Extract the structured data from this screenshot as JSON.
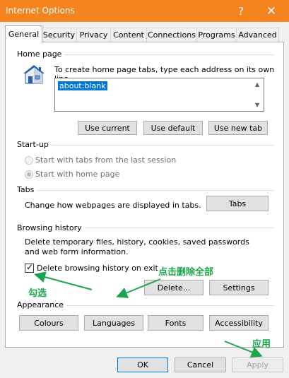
{
  "window": {
    "title": "Internet Options",
    "help_glyph": "?",
    "close_glyph": "✕",
    "accent_color": "#f5841f"
  },
  "tabs": [
    {
      "label": "General",
      "active": true
    },
    {
      "label": "Security"
    },
    {
      "label": "Privacy"
    },
    {
      "label": "Content"
    },
    {
      "label": "Connections"
    },
    {
      "label": "Programs"
    },
    {
      "label": "Advanced"
    }
  ],
  "home_page": {
    "group_label": "Home page",
    "icon": "house-icon",
    "description": "To create home page tabs, type each address on its own line.",
    "value": "about:blank",
    "buttons": {
      "use_current": "Use current",
      "use_default": "Use default",
      "use_new_tab": "Use new tab"
    }
  },
  "startup": {
    "group_label": "Start-up",
    "option_last_session": "Start with tabs from the last session",
    "option_home_page": "Start with home page",
    "selected": "home_page"
  },
  "tabs_group": {
    "group_label": "Tabs",
    "description": "Change how webpages are displayed in tabs.",
    "button": "Tabs"
  },
  "browsing_history": {
    "group_label": "Browsing history",
    "description": "Delete temporary files, history, cookies, saved passwords and web form information.",
    "checkbox_label": "Delete browsing history on exit",
    "checkbox_checked": true,
    "delete_button": "Delete...",
    "settings_button": "Settings"
  },
  "appearance": {
    "group_label": "Appearance",
    "buttons": {
      "colours": "Colours",
      "languages": "Languages",
      "fonts": "Fonts",
      "accessibility": "Accessibility"
    }
  },
  "footer": {
    "ok": "OK",
    "cancel": "Cancel",
    "apply": "Apply"
  },
  "annotations": {
    "delete_all": "点击删除全部",
    "check": "勾选",
    "apply": "应用",
    "color": "#19a64b"
  }
}
